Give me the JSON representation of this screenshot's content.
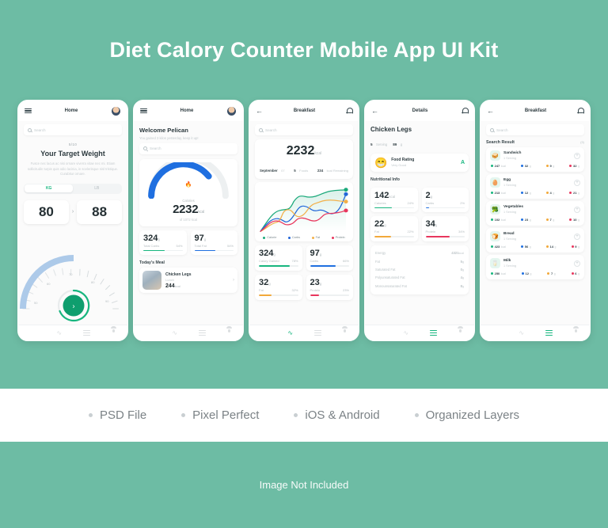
{
  "hero": {
    "title": "Diet Calory Counter Mobile App UI Kit"
  },
  "screen1": {
    "appbar": {
      "title": "Home",
      "menu_icon": "hamburger-icon",
      "avatar_icon": "avatar"
    },
    "search": {
      "placeholder": "Search"
    },
    "step": "5/10",
    "heading": "Your Target Weight",
    "body": "Fusce nec lacus ac nisi ornare viverra vitae nec mi. Etiam sollicitudin turpis quis odio lacinia, in scelerisque nisl tristique. Curabitur ornare.",
    "units": [
      {
        "label": "KG",
        "selected": true
      },
      {
        "label": "LB",
        "selected": false
      }
    ],
    "current_weight": "80",
    "arrow": "›",
    "target_weight": "88",
    "gauge_ticks": [
      "50",
      "60",
      "70",
      "80",
      "90"
    ],
    "gauge_value": 70,
    "cta_icon": "chevron-right-icon",
    "tabs": [
      "grid-icon",
      "pulse-icon",
      "list-icon",
      "person-icon"
    ],
    "active_tab": 0
  },
  "screen2": {
    "appbar": {
      "title": "Home"
    },
    "welcome": "Welcome Pelican",
    "welcome_sub": "You gained 3 kilos yesterday, keep it up!",
    "search": {
      "placeholder": "Search"
    },
    "calories": {
      "label": "Calories",
      "value": "2232",
      "unit": "kcal",
      "of": "of 1072 kcal",
      "ring_icon": "flame-icon",
      "percent": 68
    },
    "stats": [
      {
        "value": "324",
        "unit": "g",
        "name": "Total Carbs",
        "pct": "54%",
        "fill": 54,
        "color": "#17b67f"
      },
      {
        "value": "97",
        "unit": "g",
        "name": "Total Fat",
        "pct": "54%",
        "fill": 54,
        "color": "#1f6fe0"
      }
    ],
    "section_title": "Today's Meal",
    "meal": {
      "name": "Chicken Legs",
      "type": "Lunch",
      "kcal": "244",
      "kcal_unit": "kcal",
      "chevron": "›"
    },
    "tabs": [
      "grid-icon",
      "pulse-icon",
      "list-icon",
      "person-icon"
    ],
    "active_tab": 0
  },
  "screen3": {
    "appbar": {
      "title": "Breakfast",
      "back_icon": "back-arrow-icon",
      "bell_icon": "bell-icon"
    },
    "search": {
      "placeholder": "Search"
    },
    "total": {
      "value": "2232",
      "unit": "kcal"
    },
    "meta": [
      {
        "bold": "September",
        "light": "07"
      },
      {
        "bold": "5",
        "light": "Foods"
      },
      {
        "bold": "234",
        "light": "kcal Remaining"
      }
    ],
    "stats": [
      {
        "value": "324",
        "unit": "g",
        "name": "Calory Gained",
        "pct": "78%",
        "fill": 78,
        "color": "#17b67f"
      },
      {
        "value": "97",
        "unit": "g",
        "name": "Carbs",
        "pct": "66%",
        "fill": 66,
        "color": "#1f6fe0"
      },
      {
        "value": "32",
        "unit": "g",
        "name": "Fat",
        "pct": "32%",
        "fill": 32,
        "color": "#f2a93b"
      },
      {
        "value": "23",
        "unit": "g",
        "name": "Protein",
        "pct": "23%",
        "fill": 23,
        "color": "#e8365d"
      }
    ],
    "tabs": [
      "grid-icon",
      "pulse-icon",
      "list-icon",
      "person-icon"
    ],
    "active_tab": 1,
    "chart_data": {
      "type": "line",
      "title": "",
      "xlabel": "",
      "ylabel": "",
      "x": [
        0,
        1,
        2,
        3,
        4,
        5,
        6,
        7
      ],
      "ylim": [
        0,
        100
      ],
      "grid": false,
      "legend_position": "bottom",
      "series": [
        {
          "name": "Calorie",
          "color": "#1aa97a",
          "values": [
            2,
            30,
            42,
            40,
            62,
            78,
            74,
            90
          ]
        },
        {
          "name": "Carbs",
          "color": "#2266d8",
          "values": [
            2,
            24,
            18,
            38,
            40,
            52,
            44,
            88
          ]
        },
        {
          "name": "Fat",
          "color": "#f3b04a",
          "values": [
            2,
            10,
            30,
            22,
            34,
            58,
            54,
            70
          ]
        },
        {
          "name": "Protein",
          "color": "#e8365d",
          "values": [
            2,
            22,
            14,
            20,
            22,
            34,
            28,
            48
          ]
        }
      ]
    }
  },
  "screen4": {
    "appbar": {
      "title": "Details",
      "back_icon": "back-arrow-icon",
      "bell_icon": "bell-icon"
    },
    "title": "Chicken Legs",
    "serving_value": "5",
    "serving_label": "Serving",
    "weight_value": "89",
    "weight_label": "g",
    "rating": {
      "emoji": "😁",
      "name": "Food Rating",
      "value": "Very Good",
      "grade": "A"
    },
    "section_title": "Nutritional Info",
    "nutrients": [
      {
        "value": "142",
        "unit": "kcal",
        "name": "Calories",
        "pct": "24%",
        "fill": 24,
        "color": "#17b67f"
      },
      {
        "value": "2",
        "unit": "g",
        "name": "Carbs",
        "pct": "2%",
        "fill": 4,
        "color": "#1f6fe0"
      },
      {
        "value": "22",
        "unit": "g",
        "name": "Fat",
        "pct": "22%",
        "fill": 22,
        "color": "#f2a93b"
      },
      {
        "value": "34",
        "unit": "g",
        "name": "Protein",
        "pct": "34%",
        "fill": 34,
        "color": "#e8365d"
      }
    ],
    "list": [
      {
        "name": "Energy",
        "value": "4321",
        "unit": "kcal"
      },
      {
        "name": "Fat",
        "value": "5",
        "unit": "g"
      },
      {
        "name": "Saturated Fat",
        "value": "0",
        "unit": "g"
      },
      {
        "name": "Polyunsaturated Fat",
        "value": "4",
        "unit": "g"
      },
      {
        "name": "Monounsaturated Fat",
        "value": "8",
        "unit": "g"
      }
    ],
    "tabs": [
      "grid-icon",
      "pulse-icon",
      "list-icon",
      "person-icon"
    ],
    "active_tab": 2
  },
  "screen5": {
    "appbar": {
      "title": "Breakfast",
      "back_icon": "back-arrow-icon",
      "bell_icon": "bell-icon"
    },
    "search": {
      "placeholder": "Search"
    },
    "result_title": "Search Result",
    "result_count": "(5)",
    "foods": [
      {
        "name": "Sandwich",
        "serving": "1 Serving",
        "icon": "sandwich-icon",
        "glyph": "🥪",
        "macros": [
          {
            "v": "247",
            "u": "kcal",
            "c": "#17b67f"
          },
          {
            "v": "32",
            "u": "g",
            "c": "#1f6fe0"
          },
          {
            "v": "9",
            "u": "g",
            "c": "#f2a93b"
          },
          {
            "v": "32",
            "u": "g",
            "c": "#e8365d"
          }
        ]
      },
      {
        "name": "Egg",
        "serving": "1 Serving",
        "icon": "egg-icon",
        "glyph": "🥚",
        "macros": [
          {
            "v": "213",
            "u": "kcal",
            "c": "#17b67f"
          },
          {
            "v": "12",
            "u": "g",
            "c": "#1f6fe0"
          },
          {
            "v": "4",
            "u": "g",
            "c": "#f2a93b"
          },
          {
            "v": "21",
            "u": "g",
            "c": "#e8365d"
          }
        ]
      },
      {
        "name": "Vegetables",
        "serving": "1 Serving",
        "icon": "vegetables-icon",
        "glyph": "🥦",
        "macros": [
          {
            "v": "102",
            "u": "kcal",
            "c": "#17b67f"
          },
          {
            "v": "23",
            "u": "g",
            "c": "#1f6fe0"
          },
          {
            "v": "7",
            "u": "g",
            "c": "#f2a93b"
          },
          {
            "v": "10",
            "u": "g",
            "c": "#e8365d"
          }
        ]
      },
      {
        "name": "Bread",
        "serving": "1 Serving",
        "icon": "bread-icon",
        "glyph": "🍞",
        "macros": [
          {
            "v": "423",
            "u": "kcal",
            "c": "#17b67f"
          },
          {
            "v": "56",
            "u": "g",
            "c": "#1f6fe0"
          },
          {
            "v": "14",
            "u": "g",
            "c": "#f2a93b"
          },
          {
            "v": "9",
            "u": "g",
            "c": "#e8365d"
          }
        ]
      },
      {
        "name": "Milk",
        "serving": "1 Serving",
        "icon": "milk-icon",
        "glyph": "🥛",
        "macros": [
          {
            "v": "250",
            "u": "kcal",
            "c": "#17b67f"
          },
          {
            "v": "12",
            "u": "g",
            "c": "#1f6fe0"
          },
          {
            "v": "7",
            "u": "g",
            "c": "#f2a93b"
          },
          {
            "v": "6",
            "u": "g",
            "c": "#e8365d"
          }
        ]
      }
    ],
    "add_icon": "plus-icon",
    "tabs": [
      "grid-icon",
      "pulse-icon",
      "list-icon",
      "person-icon"
    ],
    "active_tab": 2
  },
  "features": [
    "PSD File",
    "Pixel Perfect",
    "iOS & Android",
    "Organized Layers"
  ],
  "footer_note": "Image Not Included",
  "colors": {
    "background": "#6dbca4",
    "accent_green": "#17b67f",
    "accent_blue": "#1f6fe0",
    "accent_orange": "#f2a93b",
    "accent_red": "#e8365d"
  }
}
